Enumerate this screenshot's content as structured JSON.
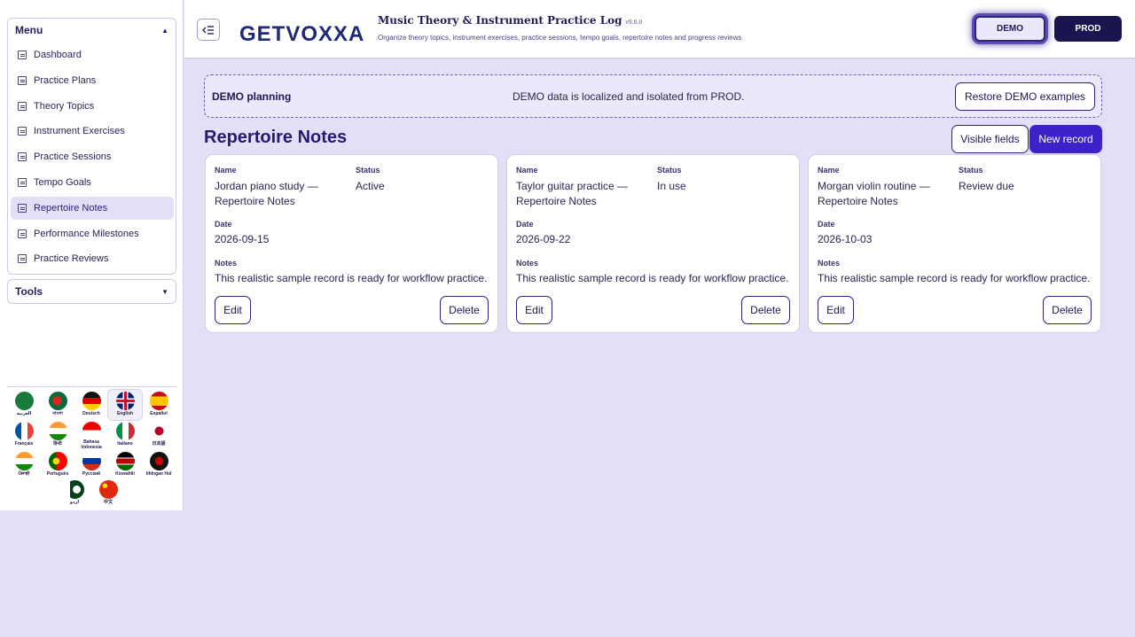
{
  "sidebar": {
    "menu_title": "Menu",
    "tools_title": "Tools",
    "items": [
      {
        "label": "Dashboard"
      },
      {
        "label": "Practice Plans"
      },
      {
        "label": "Theory Topics"
      },
      {
        "label": "Instrument Exercises"
      },
      {
        "label": "Practice Sessions"
      },
      {
        "label": "Tempo Goals"
      },
      {
        "label": "Repertoire Notes"
      },
      {
        "label": "Performance Milestones"
      },
      {
        "label": "Practice Reviews"
      }
    ],
    "active_item": "Repertoire Notes",
    "languages": [
      {
        "label": "العربية"
      },
      {
        "label": "বাংলা"
      },
      {
        "label": "Deutsch"
      },
      {
        "label": "English"
      },
      {
        "label": "Español"
      },
      {
        "label": "Français"
      },
      {
        "label": "हिन्दी"
      },
      {
        "label": "Bahasa Indonesia"
      },
      {
        "label": "Italiano"
      },
      {
        "label": "日本語"
      },
      {
        "label": "ਪੰਜਾਬੀ"
      },
      {
        "label": "Português"
      },
      {
        "label": "Русский"
      },
      {
        "label": "Kiswahili"
      },
      {
        "label": "tlhIngan Hol"
      },
      {
        "label": "اردو"
      },
      {
        "label": "中文"
      }
    ],
    "selected_language": "English"
  },
  "header": {
    "logo_text": "GETVOXXA",
    "title": "Music Theory & Instrument Practice Log",
    "version": "v9.0.0",
    "subtitle": "Organize theory topics, instrument exercises, practice sessions, tempo goals, repertoire notes and progress reviews",
    "demo_label": "DEMO",
    "prod_label": "PROD"
  },
  "banner": {
    "left": "DEMO planning",
    "message": "DEMO data is localized and isolated from PROD.",
    "restore_label": "Restore DEMO examples"
  },
  "page": {
    "title": "Repertoire Notes",
    "visible_fields_label": "Visible fields",
    "new_record_label": "New record"
  },
  "field_labels": {
    "name": "Name",
    "status": "Status",
    "date": "Date",
    "notes": "Notes",
    "edit": "Edit",
    "delete": "Delete"
  },
  "records": [
    {
      "name": "Jordan piano study — Repertoire Notes",
      "status": "Active",
      "date": "2026-09-15",
      "notes": "This realistic sample record is ready for workflow practice."
    },
    {
      "name": "Taylor guitar practice — Repertoire Notes",
      "status": "In use",
      "date": "2026-09-22",
      "notes": "This realistic sample record is ready for workflow practice."
    },
    {
      "name": "Morgan violin routine — Repertoire Notes",
      "status": "Review due",
      "date": "2026-10-03",
      "notes": "This realistic sample record is ready for workflow practice."
    }
  ],
  "colors": {
    "accent": "#3b22c9",
    "navy": "#1a154e",
    "background": "#e4dff6"
  }
}
